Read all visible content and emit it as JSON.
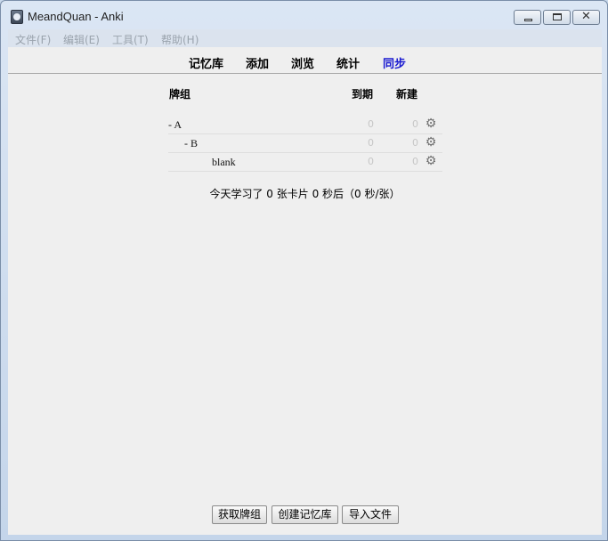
{
  "window": {
    "title": "MeandQuan - Anki",
    "controls": {
      "minimize": "",
      "maximize": "",
      "close": "✕"
    }
  },
  "menubar": {
    "items": [
      {
        "label": "文件(F)"
      },
      {
        "label": "编辑(E)"
      },
      {
        "label": "工具(T)"
      },
      {
        "label": "帮助(H)"
      }
    ]
  },
  "toolbar": {
    "items": [
      {
        "label": "记忆库"
      },
      {
        "label": "添加"
      },
      {
        "label": "浏览"
      },
      {
        "label": "统计"
      },
      {
        "label": "同步"
      }
    ]
  },
  "deck_table": {
    "headers": {
      "deck": "牌组",
      "due": "到期",
      "new": "新建"
    },
    "rows": [
      {
        "name": "-  A",
        "due": "0",
        "new": "0"
      },
      {
        "name": "-  B",
        "due": "0",
        "new": "0"
      },
      {
        "name": "blank",
        "due": "0",
        "new": "0"
      }
    ]
  },
  "summary": "今天学习了 0 张卡片 0 秒后（0 秒/张）",
  "buttons": {
    "get_shared": "获取牌组",
    "create_deck": "创建记忆库",
    "import_file": "导入文件"
  },
  "icons": {
    "app": "anki-icon",
    "gear": "gear-icon"
  },
  "colors": {
    "sync_link": "#1a1ad0",
    "muted_count": "#c6c6c6"
  }
}
